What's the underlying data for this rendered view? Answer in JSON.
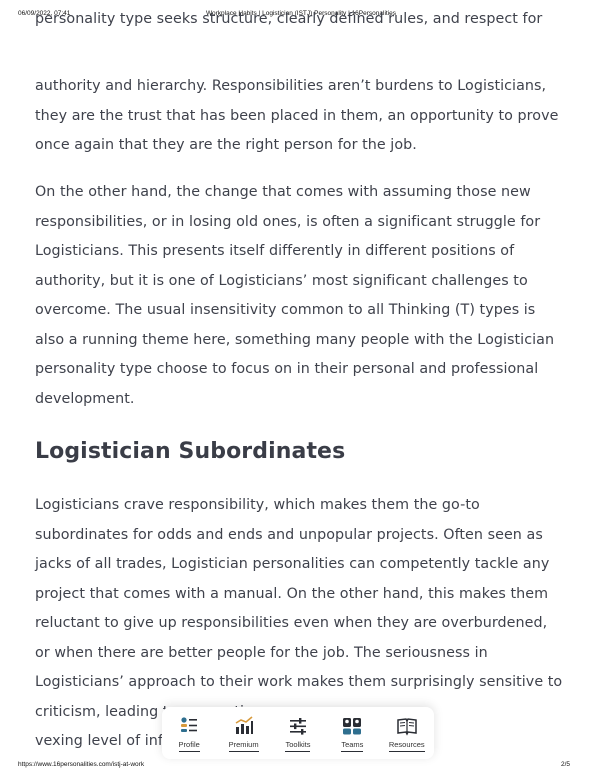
{
  "print_header": {
    "date": "06/09/2022, 07:41",
    "title": "Workplace Habits | Logistician (ISTJ) Personality | 16Personalities"
  },
  "article": {
    "cut_line": "personality type seeks structure, clearly defined rules, and respect for",
    "paragraph1": "authority and hierarchy. Responsibilities aren’t burdens to Logisticians, they are the trust that has been placed in them, an opportunity to prove once again that they are the right person for the job.",
    "paragraph2": "On the other hand, the change that comes with assuming those new responsibilities, or in losing old ones, is often a significant struggle for Logisticians. This presents itself differently in different positions of authority, but it is one of Logisticians’ most significant challenges to overcome. The usual insensitivity common to all Thinking (T) types is also a running theme here, something many people with the Logistician personality type choose to focus on in their personal and professional development.",
    "heading": "Logistician Subordinates",
    "paragraph3": "Logisticians crave responsibility, which makes them the go-to subordinates for odds and ends and unpopular projects. Often seen as jacks of all trades, Logistician personalities can competently tackle any project that comes with a manual. On the other hand, this makes them reluctant to give up responsibilities even when they are overburdened, or when there are better people for the job. The seriousness in Logisticians’ approach to their work makes them surprisingly sensitive to criticism, leading to a sometimes",
    "paragraph3_tail": "vexing level of infle"
  },
  "bottom_nav": {
    "items": [
      {
        "label": "Profile",
        "icon": "profile-icon"
      },
      {
        "label": "Premium",
        "icon": "chart-icon"
      },
      {
        "label": "Toolkits",
        "icon": "sliders-icon"
      },
      {
        "label": "Teams",
        "icon": "teams-icon"
      },
      {
        "label": "Resources",
        "icon": "book-icon"
      }
    ]
  },
  "print_footer": {
    "url": "https://www.16personalities.com/istj-at-work",
    "page": "2/5"
  }
}
